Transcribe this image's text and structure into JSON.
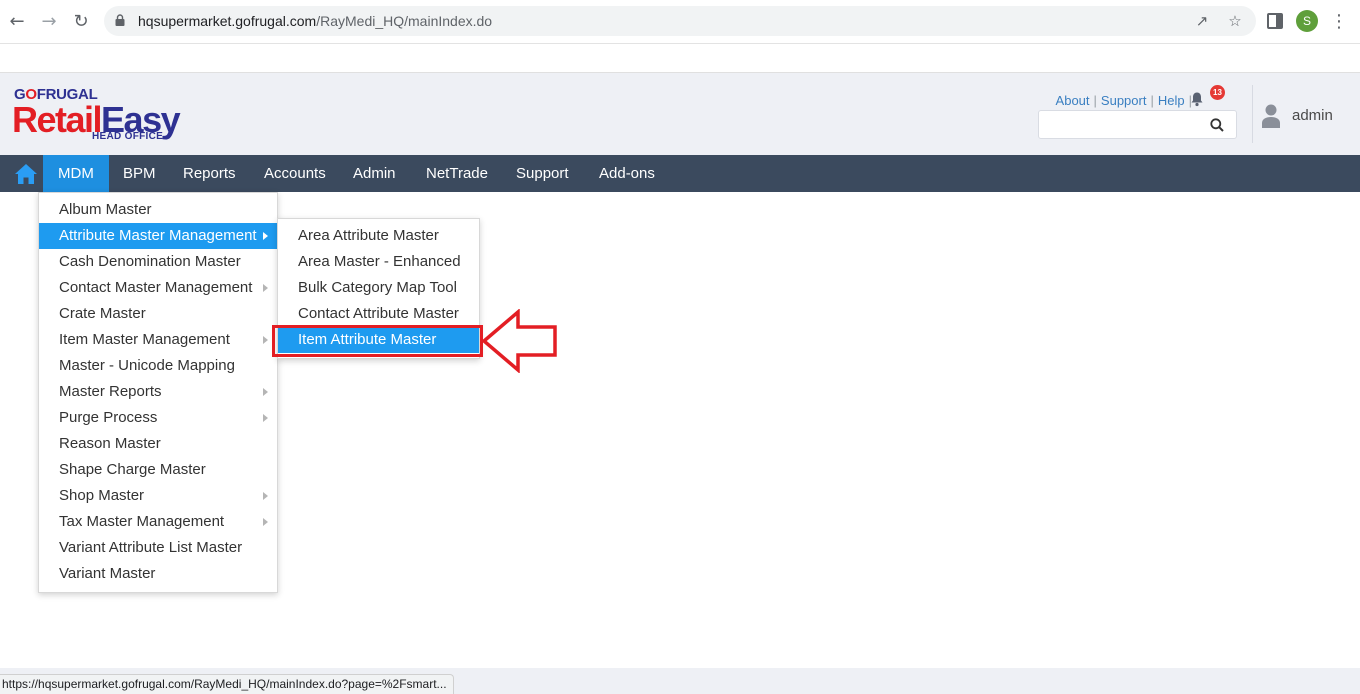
{
  "browser": {
    "url_domain": "hqsupermarket.gofrugal.com",
    "url_path": "/RayMedi_HQ/mainIndex.do",
    "profile_initial": "S",
    "status_url": "https://hqsupermarket.gofrugal.com/RayMedi_HQ/mainIndex.do?page=%2Fsmart..."
  },
  "logo": {
    "brand_prefix": "G",
    "brand_o": "O",
    "brand_suffix": "FRUGAL",
    "product_red": "Retail",
    "product_blue": "Easy",
    "subtitle": "HEAD OFFICE"
  },
  "header": {
    "links": [
      "About",
      "Support",
      "Help"
    ],
    "notification_count": "13",
    "search_placeholder": "",
    "user_name": "admin"
  },
  "nav": {
    "items": [
      "MDM",
      "BPM",
      "Reports",
      "Accounts",
      "Admin",
      "NetTrade",
      "Support",
      "Add-ons"
    ],
    "active": "MDM"
  },
  "mdm_menu": {
    "items": [
      {
        "label": "Album Master",
        "has_submenu": false
      },
      {
        "label": "Attribute Master Management",
        "has_submenu": true,
        "active": true
      },
      {
        "label": "Cash Denomination Master",
        "has_submenu": false
      },
      {
        "label": "Contact Master Management",
        "has_submenu": true
      },
      {
        "label": "Crate Master",
        "has_submenu": false
      },
      {
        "label": "Item Master Management",
        "has_submenu": true
      },
      {
        "label": "Master - Unicode Mapping",
        "has_submenu": false
      },
      {
        "label": "Master Reports",
        "has_submenu": true
      },
      {
        "label": "Purge Process",
        "has_submenu": true
      },
      {
        "label": "Reason Master",
        "has_submenu": false
      },
      {
        "label": "Shape Charge Master",
        "has_submenu": false
      },
      {
        "label": "Shop Master",
        "has_submenu": true
      },
      {
        "label": "Tax Master Management",
        "has_submenu": true
      },
      {
        "label": "Variant Attribute List Master",
        "has_submenu": false
      },
      {
        "label": "Variant Master",
        "has_submenu": false
      }
    ]
  },
  "attribute_submenu": {
    "items": [
      {
        "label": "Area Attribute Master"
      },
      {
        "label": "Area Master - Enhanced"
      },
      {
        "label": "Bulk Category Map Tool"
      },
      {
        "label": "Contact Attribute Master"
      },
      {
        "label": "Item Attribute Master",
        "active": true
      }
    ]
  },
  "colors": {
    "nav_bg": "#3b4a5e",
    "accent": "#1e8fe0",
    "highlight": "#e31e24"
  }
}
